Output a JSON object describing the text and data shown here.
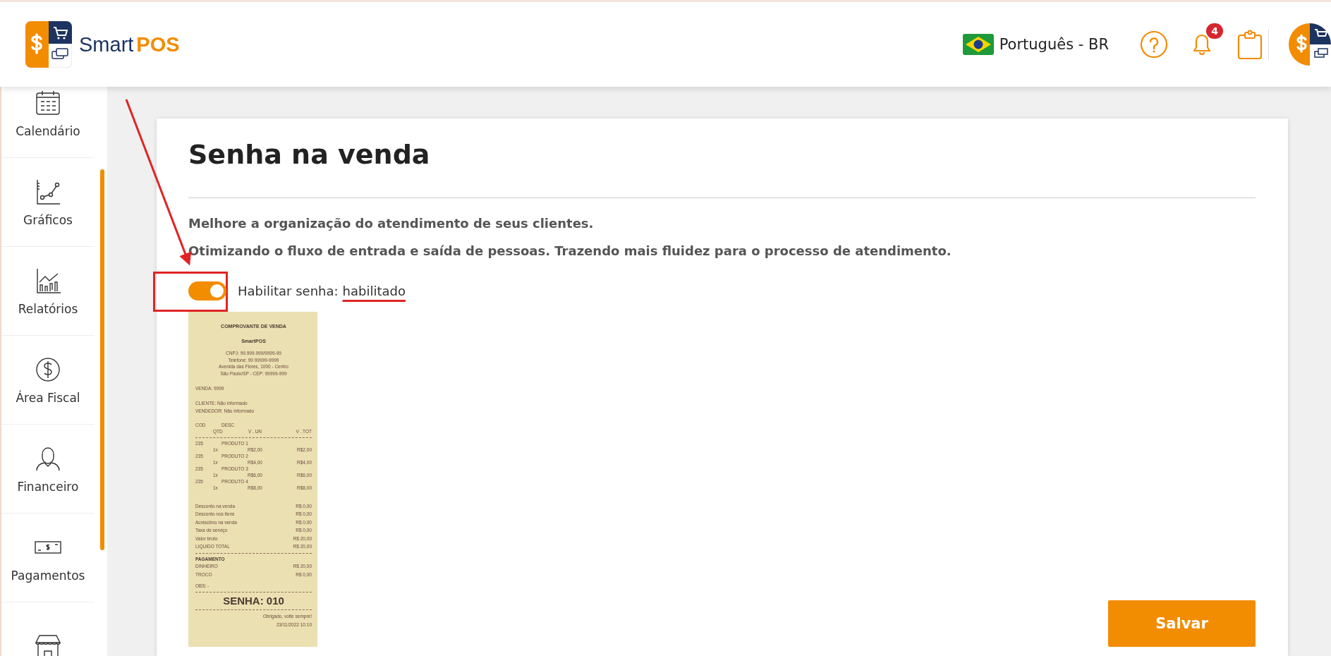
{
  "header": {
    "brand": "Smart**POS**",
    "language": "Português - BR",
    "notifications_badge": "4"
  },
  "sidebar": {
    "items": [
      {
        "kind": "calendar",
        "label": "Calendário"
      },
      {
        "kind": "chart",
        "label": "Gráficos"
      },
      {
        "kind": "report",
        "label": "Relatórios"
      },
      {
        "kind": "fiscal",
        "label": "Área Fiscal"
      },
      {
        "kind": "finance",
        "label": "Financeiro"
      },
      {
        "kind": "payment",
        "label": "Pagamentos"
      },
      {
        "kind": "store"
      }
    ]
  },
  "page": {
    "title": "Senha na venda",
    "description": [
      "Melhore a organização do atendimento de seus clientes.",
      "Otimizando o fluxo de entrada e saída de pessoas. Trazendo mais fluidez para o processo de atendimento."
    ],
    "toggle": {
      "label": "Habilitar senha:",
      "status": "habilitado",
      "on": true
    },
    "save_button": "Salvar"
  },
  "receipt": {
    "title": "COMPROVANTE DE VENDA",
    "store": "SmartPOS",
    "address_lines": [
      "CNPJ: 99.999.999/9999-99",
      "Telefone: 99 99999-9999",
      "Avenida das Flores, 1000 - Centro",
      "São Paulo/SP - CEP: 99999-999"
    ],
    "sale": "VENDA: 9999",
    "client": "CLIENTE: Não informado",
    "seller": "VENDEDOR: Não informado",
    "columns": {
      "code": "COD",
      "desc": "DESC",
      "qty": "QTD",
      "unit": "V . UN",
      "total": "V . TOT"
    },
    "items": [
      {
        "code": "235",
        "name": "PRODUTO 1",
        "qty": "1x",
        "unit": "R$2,00",
        "total": "R$2,00"
      },
      {
        "code": "235",
        "name": "PRODUTO 2",
        "qty": "1x",
        "unit": "R$4,00",
        "total": "R$4,00"
      },
      {
        "code": "235",
        "name": "PRODUTO 3",
        "qty": "1x",
        "unit": "R$6,00",
        "total": "R$6,00"
      },
      {
        "code": "235",
        "name": "PRODUTO 4",
        "qty": "1x",
        "unit": "R$8,00",
        "total": "R$8,00"
      }
    ],
    "totals": [
      {
        "label": "Desconto na venda",
        "value": "R$ 0,00"
      },
      {
        "label": "Desconto nos itens",
        "value": "R$ 0,00"
      },
      {
        "label": "Acréscimo na venda",
        "value": "R$ 0,00"
      },
      {
        "label": "Taxa de serviço",
        "value": "R$ 0,00"
      },
      {
        "label": "Valor bruto",
        "value": "R$ 20,00"
      },
      {
        "label": "LIQUIDO TOTAL",
        "value": "R$ 20,00"
      }
    ],
    "payment_title": "PAGAMENTO",
    "payments": [
      {
        "label": "DINHEIRO",
        "value": "R$ 20,00"
      },
      {
        "label": "TROCO",
        "value": "R$ 0,00"
      }
    ],
    "obs": "OBS: -",
    "password": "SENHA: 010",
    "footer": [
      "Obrigado, volte sempre!",
      "23/11/2022 10:10"
    ]
  }
}
